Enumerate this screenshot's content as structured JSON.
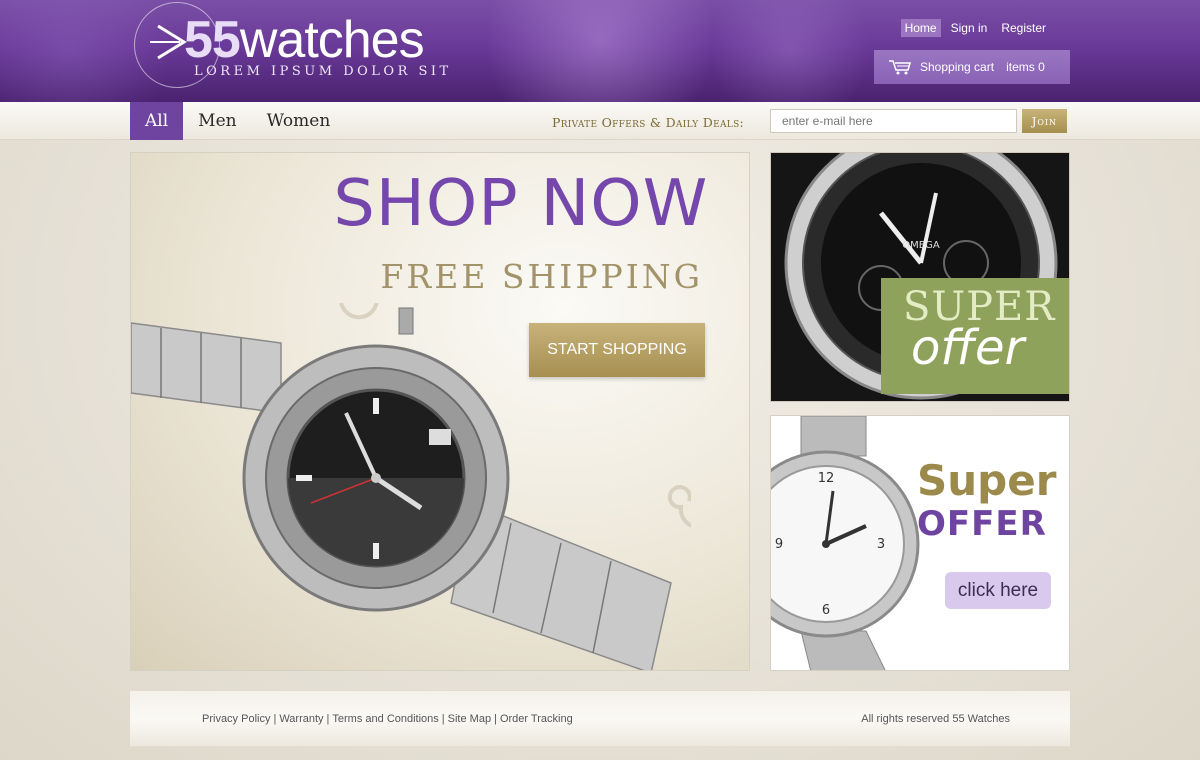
{
  "brand": {
    "logo_number": "55",
    "logo_word": "watches",
    "tagline": "LOREM IPSUM DOLOR SIT",
    "accent": "#6e44a0",
    "gold": "#a68f50"
  },
  "top_links": {
    "home": "Home",
    "sign_in": "Sign in",
    "register": "Register"
  },
  "cart": {
    "icon": "shopping-cart-icon",
    "label": "Shopping cart",
    "items": "items 0"
  },
  "nav": {
    "items": [
      {
        "label": "All",
        "active": true
      },
      {
        "label": "Men",
        "active": false
      },
      {
        "label": "Women",
        "active": false
      }
    ]
  },
  "newsletter": {
    "label": "Private Offers & Daily Deals:",
    "placeholder": "enter e-mail here",
    "join": "Join"
  },
  "hero": {
    "title": "SHOP NOW",
    "subtitle": "FREE SHIPPING",
    "cta": "START SHOPPING"
  },
  "promo1": {
    "line1": "SUPER",
    "line2": "offer",
    "watch_brand": "OMEGA"
  },
  "promo2": {
    "line1": "Super",
    "line2": "OFFER",
    "cta": "click here"
  },
  "footer": {
    "links": [
      "Privacy Policy",
      "Warranty",
      "Terms and Conditions",
      "Site Map",
      "Order Tracking"
    ],
    "rights": "All rights reserved 55 Watches"
  }
}
